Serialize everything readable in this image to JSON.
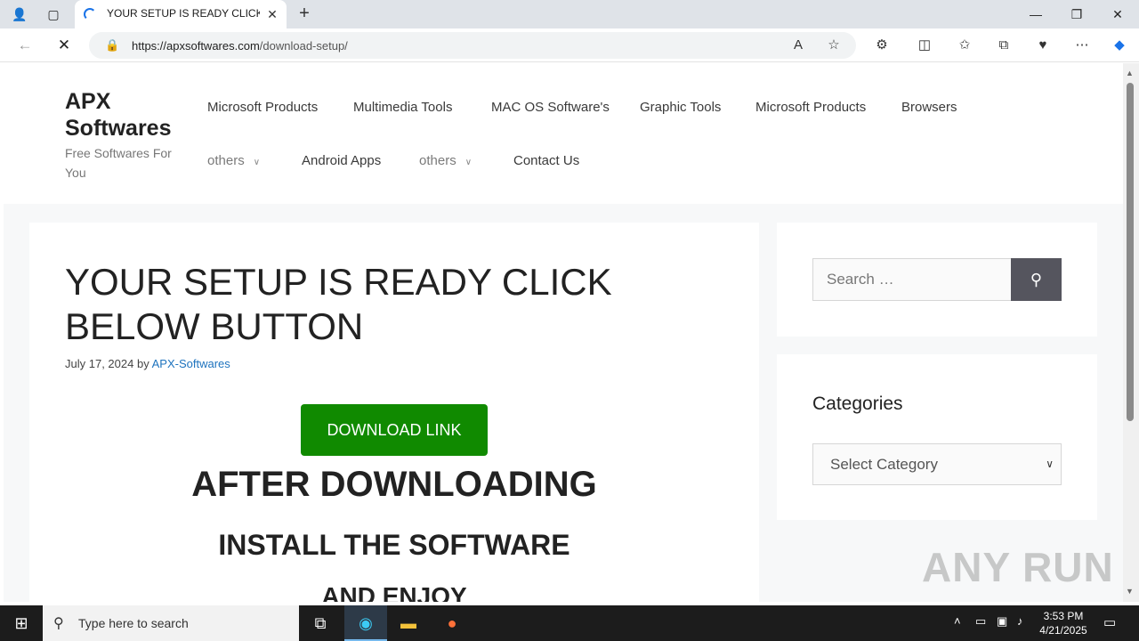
{
  "browser": {
    "tab_title": "YOUR SETUP IS READY CLICK BE",
    "url_host": "https://apxsoftwares.com",
    "url_path": "/download-setup/"
  },
  "site": {
    "title": "APX Softwares",
    "description": "Free Softwares For You"
  },
  "menu": {
    "row1": [
      "Microsoft Products",
      "Multimedia Tools",
      "MAC OS Software's",
      "Graphic Tools",
      "Microsoft Products",
      "Browsers"
    ],
    "row2": [
      "others",
      "Android Apps",
      "others",
      "Contact Us"
    ]
  },
  "article": {
    "title": "YOUR SETUP IS READY CLICK BELOW BUTTON",
    "date": "July 17, 2024",
    "by": "by",
    "author": "APX-Softwares",
    "download_label": "DOWNLOAD LINK",
    "heading1": "AFTER DOWNLOADING",
    "heading2": "INSTALL THE SOFTWARE",
    "heading3": "AND ENJOY"
  },
  "sidebar": {
    "search_placeholder": "Search …",
    "categories_title": "Categories",
    "select_value": "Select Category"
  },
  "watermark": "ANY RUN",
  "taskbar": {
    "search_placeholder": "Type here to search",
    "time": "3:53 PM",
    "date": "4/21/2025"
  },
  "colors": {
    "download_button": "#108a00",
    "link": "#1e73be",
    "search_button": "#55555e"
  }
}
